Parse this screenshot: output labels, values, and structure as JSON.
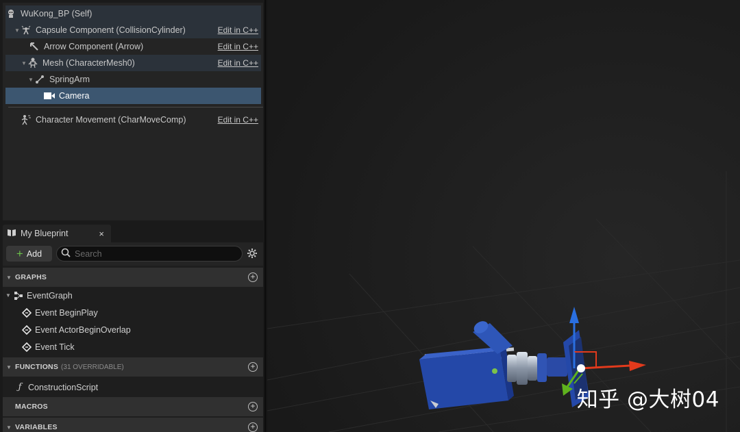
{
  "components": {
    "items": [
      {
        "label": "WuKong_BP (Self)",
        "icon": "self-icon",
        "edit": ""
      },
      {
        "label": "Capsule Component (CollisionCylinder)",
        "icon": "capsule-icon",
        "edit": "Edit in C++"
      },
      {
        "label": "Arrow Component (Arrow)",
        "icon": "arrow-component-icon",
        "edit": "Edit in C++"
      },
      {
        "label": "Mesh (CharacterMesh0)",
        "icon": "skeletal-mesh-icon",
        "edit": "Edit in C++"
      },
      {
        "label": "SpringArm",
        "icon": "spring-arm-icon",
        "edit": ""
      },
      {
        "label": "Camera",
        "icon": "camera-icon",
        "edit": ""
      },
      {
        "label": "Character Movement (CharMoveComp)",
        "icon": "movement-icon",
        "edit": "Edit in C++"
      }
    ],
    "selected": "Camera"
  },
  "blueprint": {
    "tab_title": "My Blueprint",
    "close": "×",
    "add_label": "Add",
    "search_placeholder": "Search",
    "sections": {
      "graphs": "GRAPHS",
      "functions": "FUNCTIONS",
      "functions_sub": "(31 OVERRIDABLE)",
      "macros": "MACROS",
      "variables": "VARIABLES"
    },
    "graph_items": {
      "event_graph": "EventGraph",
      "begin_play": "Event BeginPlay",
      "actor_overlap": "Event ActorBeginOverlap",
      "tick": "Event Tick"
    },
    "function_items": {
      "construction": "ConstructionScript"
    }
  },
  "viewport": {
    "watermark": "知乎 @大树04",
    "colors": {
      "gizmo_x": "#e23a1c",
      "gizmo_y": "#5fb21e",
      "gizmo_z": "#2a6fe0",
      "camera_body": "#2448a8"
    }
  }
}
